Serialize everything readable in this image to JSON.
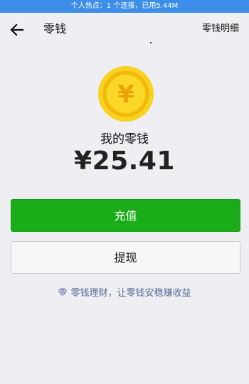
{
  "status_bar": {
    "hotspot_text": "个人热点：1 个连接，已用5.44M"
  },
  "header": {
    "title": "零钱",
    "detail_link": "零钱明细",
    "back_icon": "arrow-left-icon"
  },
  "wallet": {
    "coin_icon": "yen-coin-icon",
    "coin_symbol": "¥",
    "label": "我的零钱",
    "amount": "¥25.41"
  },
  "actions": {
    "recharge_label": "充值",
    "withdraw_label": "提现"
  },
  "promo": {
    "icon": "diamond-icon",
    "text": "零钱理财，让零钱安稳赚收益"
  },
  "colors": {
    "accent_green": "#1aad19",
    "link_blue": "#576b95",
    "hotspot_blue": "#3c8ee8",
    "coin_yellow": "#f8d21c"
  }
}
